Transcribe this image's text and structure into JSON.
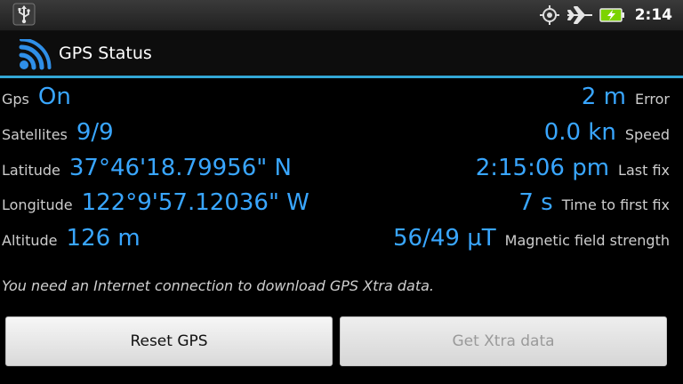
{
  "status_bar": {
    "time": "2:14",
    "icons": [
      "usb-icon",
      "gps-icon",
      "airplane-mode-icon",
      "battery-charging-icon"
    ],
    "battery_color": "#7cd300"
  },
  "app": {
    "title": "GPS Status",
    "accent": "#33a7d6",
    "value_color": "#39a6ff"
  },
  "rows": [
    {
      "left_label": "Gps",
      "left_value": "On",
      "right_value": "2 m",
      "right_label": "Error"
    },
    {
      "left_label": "Satellites",
      "left_value": "9/9",
      "right_value": "0.0 kn",
      "right_label": "Speed"
    },
    {
      "left_label": "Latitude",
      "left_value": "37°46'18.79956\" N",
      "right_value": "2:15:06 pm",
      "right_label": "Last fix"
    },
    {
      "left_label": "Longitude",
      "left_value": "122°9'57.12036\" W",
      "right_value": "7 s",
      "right_label": "Time to first fix"
    },
    {
      "left_label": "Altitude",
      "left_value": "126 m",
      "right_value": "56/49 µT",
      "right_label": "Magnetic field strength"
    }
  ],
  "notice": "You need an Internet connection to download GPS Xtra data.",
  "buttons": {
    "reset": "Reset GPS",
    "xtra": "Get Xtra data"
  }
}
